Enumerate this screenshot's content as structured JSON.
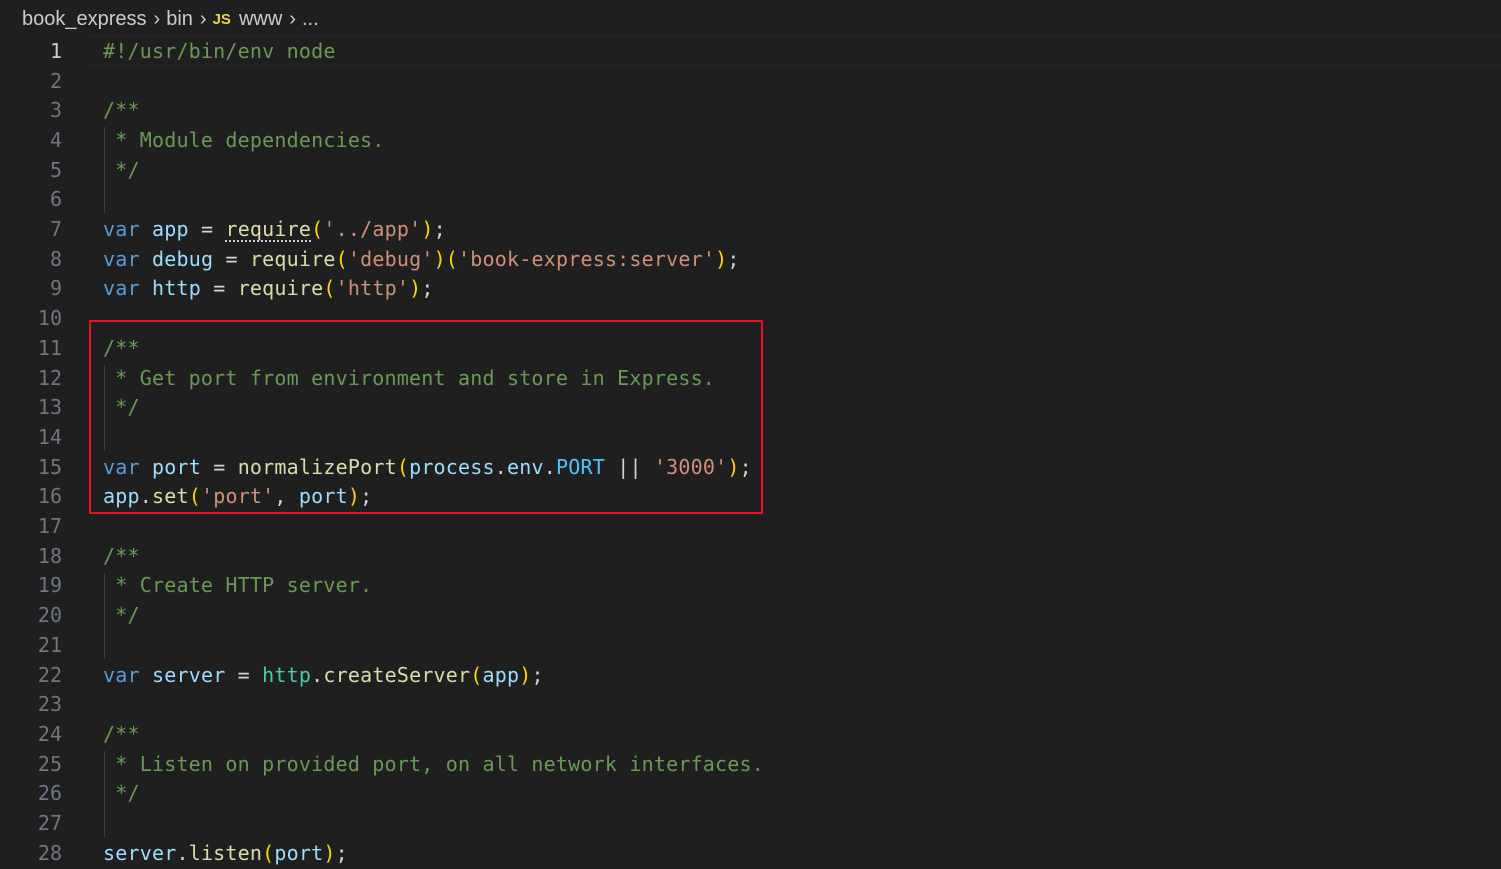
{
  "breadcrumb": {
    "folder": "book_express",
    "subfolder": "bin",
    "file_icon": "JS",
    "file": "www",
    "more": "..."
  },
  "editor": {
    "active_line": 1,
    "lines": [
      {
        "n": "1"
      },
      {
        "n": "2"
      },
      {
        "n": "3"
      },
      {
        "n": "4"
      },
      {
        "n": "5"
      },
      {
        "n": "6"
      },
      {
        "n": "7"
      },
      {
        "n": "8"
      },
      {
        "n": "9"
      },
      {
        "n": "10"
      },
      {
        "n": "11"
      },
      {
        "n": "12"
      },
      {
        "n": "13"
      },
      {
        "n": "14"
      },
      {
        "n": "15"
      },
      {
        "n": "16"
      },
      {
        "n": "17"
      },
      {
        "n": "18"
      },
      {
        "n": "19"
      },
      {
        "n": "20"
      },
      {
        "n": "21"
      },
      {
        "n": "22"
      },
      {
        "n": "23"
      },
      {
        "n": "24"
      },
      {
        "n": "25"
      },
      {
        "n": "26"
      },
      {
        "n": "27"
      },
      {
        "n": "28"
      }
    ],
    "code": {
      "l1": "#!/usr/bin/env node",
      "l3": "/**",
      "l4": " * Module dependencies.",
      "l5": " */",
      "l7": {
        "kw": "var",
        "name": "app",
        "eq": " = ",
        "fn": "require",
        "arg": "'../app'"
      },
      "l8": {
        "kw": "var",
        "name": "debug",
        "eq": " = ",
        "fn": "require",
        "arg": "'debug'",
        "arg2": "'book-express:server'"
      },
      "l9": {
        "kw": "var",
        "name": "http",
        "eq": " = ",
        "fn": "require",
        "arg": "'http'"
      },
      "l11": "/**",
      "l12": " * Get port from environment and store in Express.",
      "l13": " */",
      "l15": {
        "kw": "var",
        "name": "port",
        "eq": " = ",
        "fn": "normalizePort",
        "obj": "process",
        "prop": "env",
        "const": "PORT",
        "or": " || ",
        "arg": "'3000'"
      },
      "l16": {
        "obj": "app",
        "fn": "set",
        "arg": "'port'",
        "comma": ", ",
        "name": "port"
      },
      "l18": "/**",
      "l19": " * Create HTTP server.",
      "l20": " */",
      "l22": {
        "kw": "var",
        "name": "server",
        "eq": " = ",
        "obj": "http",
        "fn": "createServer",
        "arg": "app"
      },
      "l24": "/**",
      "l25": " * Listen on provided port, on all network interfaces.",
      "l26": " */",
      "l28": {
        "obj": "server",
        "fn": "listen",
        "arg": "port"
      }
    }
  },
  "annotation": {
    "color": "#e81123"
  }
}
